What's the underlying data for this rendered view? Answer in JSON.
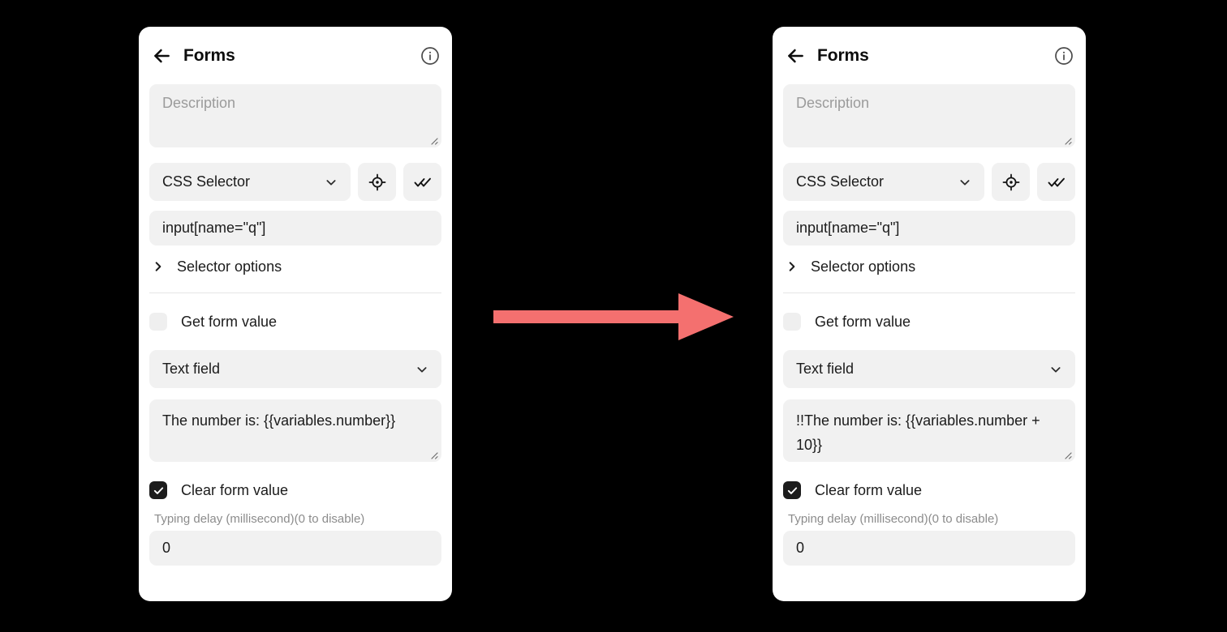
{
  "background_color": "#000000",
  "arrow": {
    "icon": "right-arrow-icon",
    "color": "#F4706F",
    "direction": "right"
  },
  "panels": [
    {
      "id": "before",
      "header": {
        "back_icon": "back-arrow-icon",
        "title": "Forms",
        "info_icon": "info-circle-icon"
      },
      "description": {
        "placeholder": "Description",
        "value": ""
      },
      "selector_type": {
        "value": "CSS Selector",
        "chevron_icon": "chevron-down-icon"
      },
      "buttons": {
        "pick_element_icon": "crosshair-target-icon",
        "validate_selector_icon": "double-check-icon"
      },
      "selector_value": "input[name=\"q\"]",
      "selector_options": {
        "label": "Selector options",
        "chevron_icon": "chevron-right-icon",
        "expanded": false
      },
      "get_form_value": {
        "label": "Get form value",
        "checked": false
      },
      "form_type": {
        "value": "Text field",
        "chevron_icon": "chevron-down-icon"
      },
      "form_value": "The number is: {{variables.number}}",
      "clear_form_value": {
        "label": "Clear form value",
        "checked": true
      },
      "typing_delay": {
        "label": "Typing delay (millisecond)(0 to disable)",
        "value": "0"
      }
    },
    {
      "id": "after",
      "header": {
        "back_icon": "back-arrow-icon",
        "title": "Forms",
        "info_icon": "info-circle-icon"
      },
      "description": {
        "placeholder": "Description",
        "value": ""
      },
      "selector_type": {
        "value": "CSS Selector",
        "chevron_icon": "chevron-down-icon"
      },
      "buttons": {
        "pick_element_icon": "crosshair-target-icon",
        "validate_selector_icon": "double-check-icon"
      },
      "selector_value": "input[name=\"q\"]",
      "selector_options": {
        "label": "Selector options",
        "chevron_icon": "chevron-right-icon",
        "expanded": false
      },
      "get_form_value": {
        "label": "Get form value",
        "checked": false
      },
      "form_type": {
        "value": "Text field",
        "chevron_icon": "chevron-down-icon"
      },
      "form_value": "!!The number is: {{variables.number + 10}}",
      "clear_form_value": {
        "label": "Clear form value",
        "checked": true
      },
      "typing_delay": {
        "label": "Typing delay (millisecond)(0 to disable)",
        "value": "0"
      }
    }
  ]
}
